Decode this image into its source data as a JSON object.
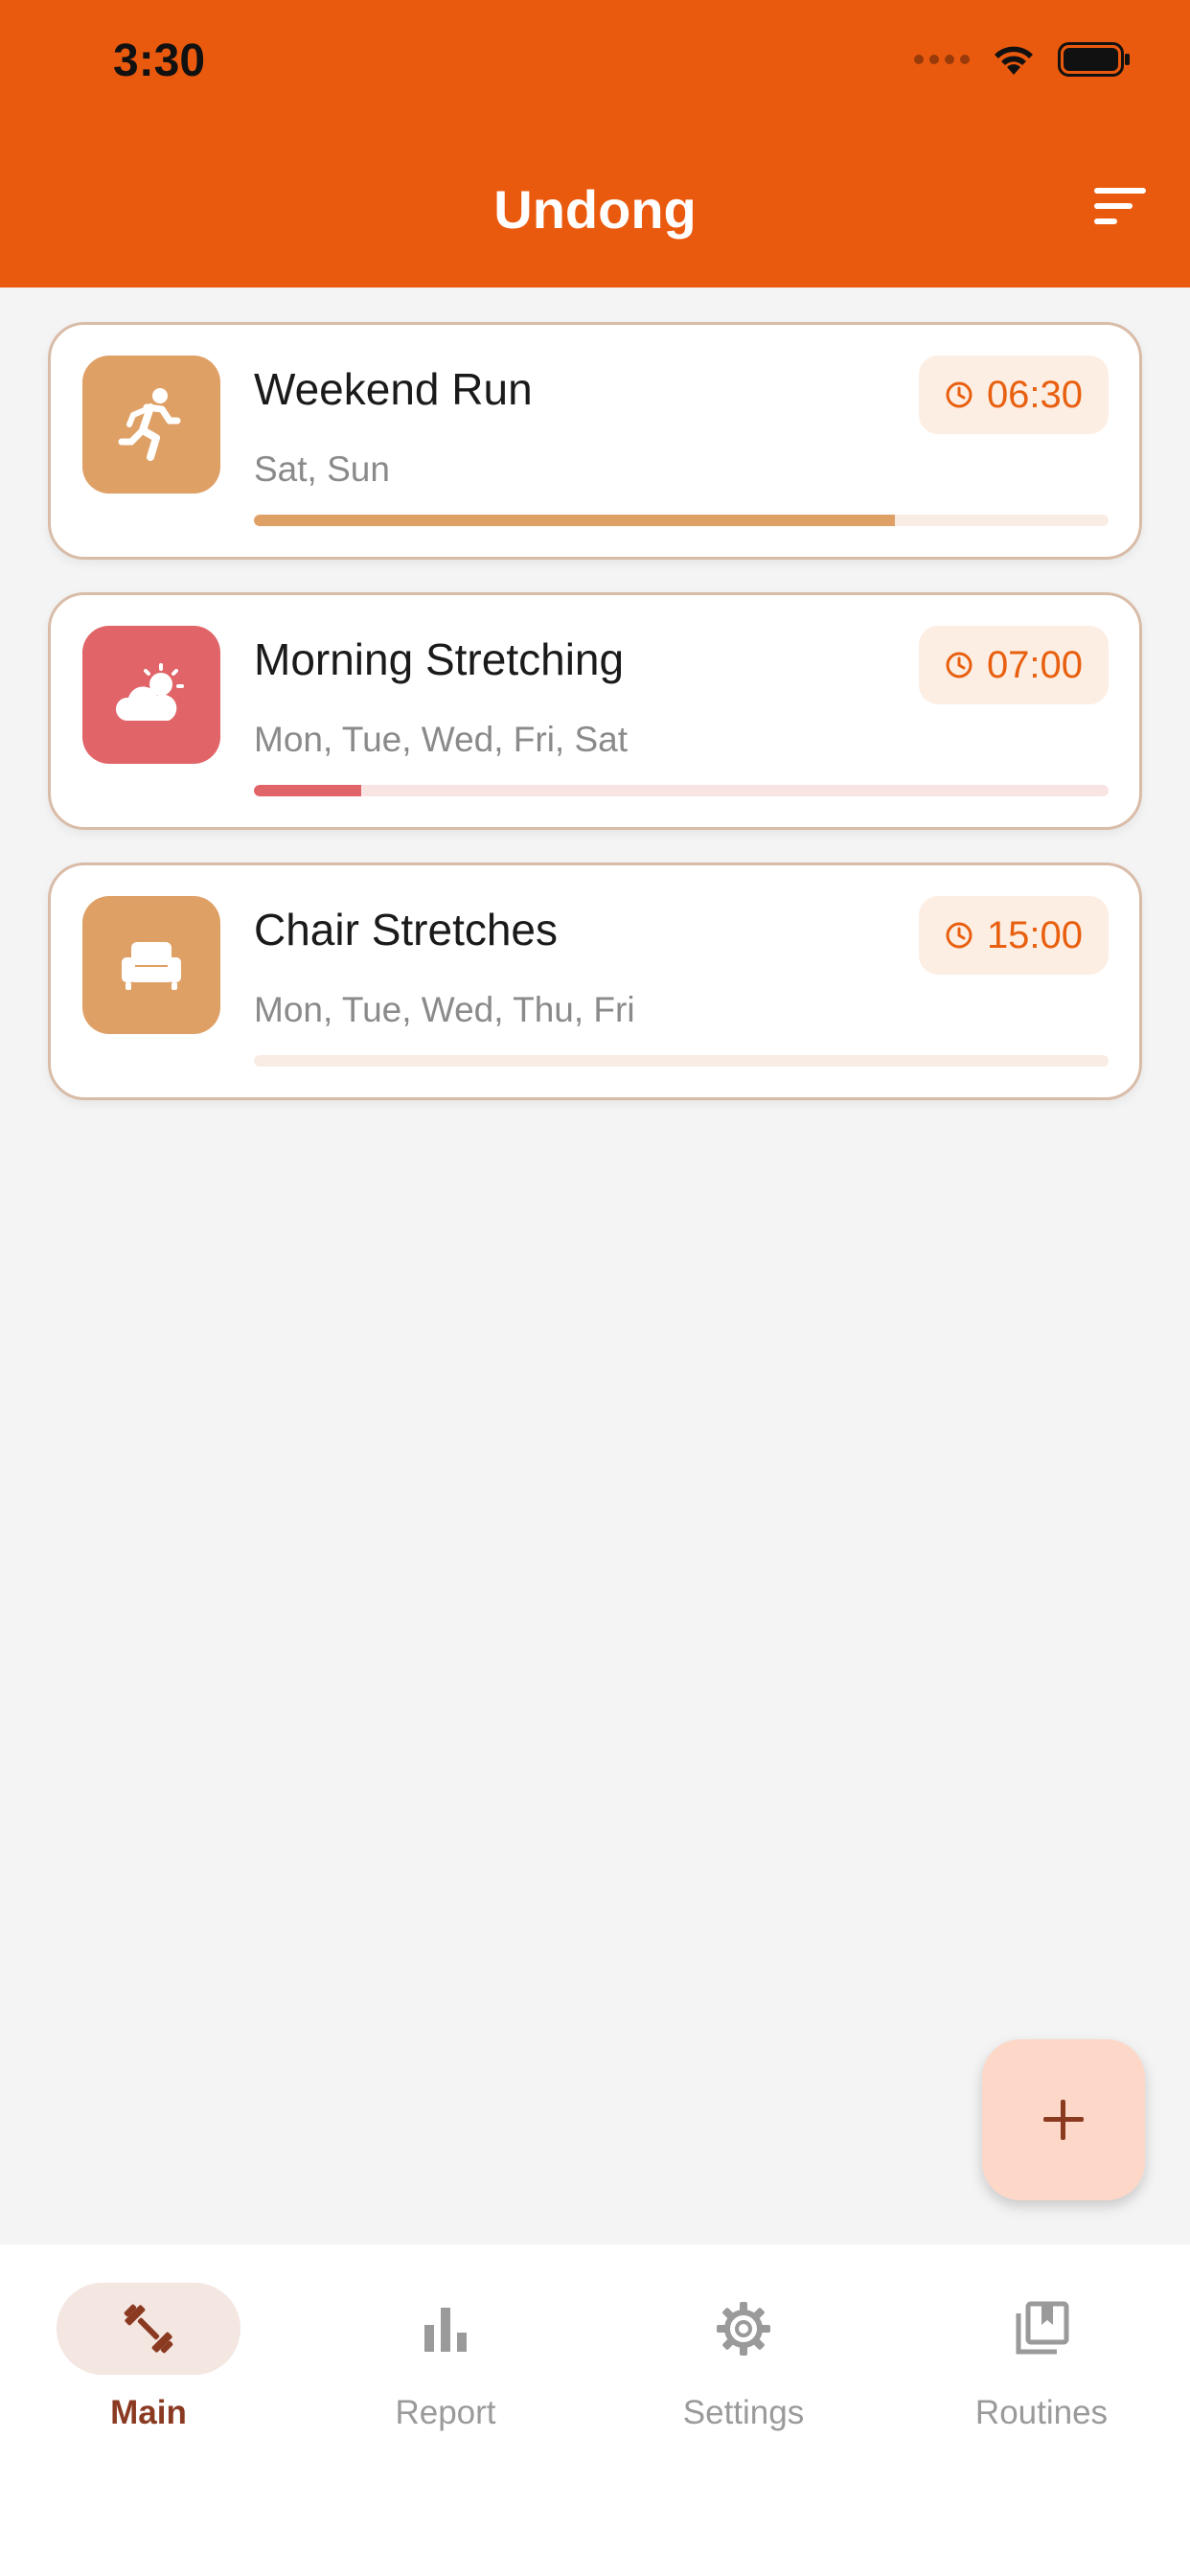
{
  "status_bar": {
    "time": "3:30"
  },
  "header": {
    "title": "Undong",
    "filter_icon": "sort-filter-icon"
  },
  "routines": [
    {
      "title": "Weekend Run",
      "days": "Sat, Sun",
      "time": "06:30",
      "icon": "running-person-icon",
      "icon_bg": "#dfa066",
      "progress": 0.75,
      "progress_color": "#dfa066",
      "track_color": "#f8ece4"
    },
    {
      "title": "Morning Stretching",
      "days": "Mon, Tue, Wed, Fri, Sat",
      "time": "07:00",
      "icon": "sun-behind-cloud-icon",
      "icon_bg": "#e06468",
      "progress": 0.125,
      "progress_color": "#e06468",
      "track_color": "#f9e4e4"
    },
    {
      "title": "Chair Stretches",
      "days": "Mon, Tue, Wed, Thu, Fri",
      "time": "15:00",
      "icon": "armchair-icon",
      "icon_bg": "#dfa066",
      "progress": 0,
      "progress_color": "#dfa066",
      "track_color": "#f8ece4"
    }
  ],
  "fab": {
    "icon": "plus-icon"
  },
  "tabs": [
    {
      "label": "Main",
      "icon": "dumbbell-icon",
      "active": true
    },
    {
      "label": "Report",
      "icon": "bar-chart-icon",
      "active": false
    },
    {
      "label": "Settings",
      "icon": "gear-icon",
      "active": false
    },
    {
      "label": "Routines",
      "icon": "bookmark-collection-icon",
      "active": false
    }
  ],
  "colors": {
    "accent": "#ea5a0e",
    "active_tab": "#8b3a22",
    "time_text": "#e8600f"
  }
}
